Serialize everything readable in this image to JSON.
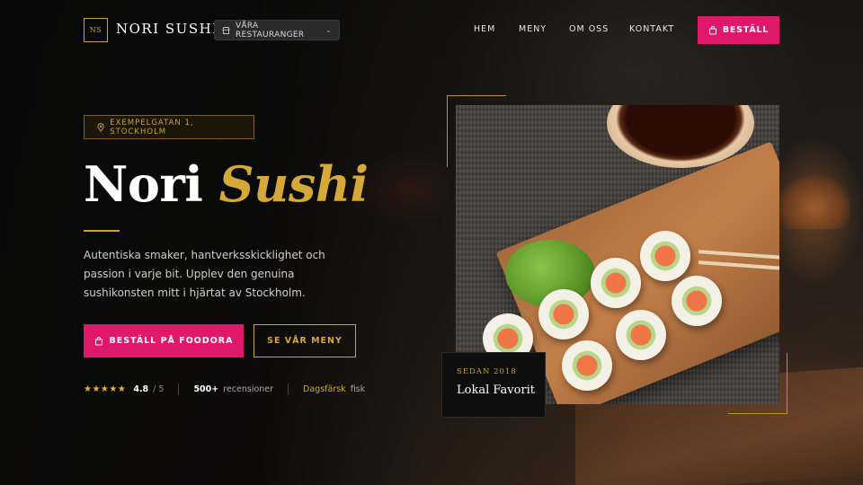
{
  "header": {
    "logo_mark": "NS",
    "logo_text": "NORI SUSHI",
    "restaurant_select": {
      "label": "VÅRA RESTAURANGER",
      "icon": "store-icon"
    },
    "nav": [
      {
        "label": "HEM"
      },
      {
        "label": "MENY"
      },
      {
        "label": "OM OSS"
      },
      {
        "label": "KONTAKT"
      }
    ],
    "order_button": {
      "label": "BESTÄLL",
      "icon": "bag-icon"
    }
  },
  "hero": {
    "address": "EXEMPELGATAN 1, STOCKHOLM",
    "title_main": "Nori ",
    "title_accent": "Sushi",
    "description": "Autentiska smaker, hantverksskicklighet och passion i varje bit. Upplev den genuina sushikonsten mitt i hjärtat av Stockholm.",
    "cta_primary": "BESTÄLL PÅ FOODORA",
    "cta_secondary": "SE VÅR MENY"
  },
  "stats": {
    "stars": "★★★★★",
    "rating": "4.8",
    "rating_max": "/ 5",
    "review_count": "500+",
    "review_label": "recensioner",
    "fresh": "Dagsfärsk",
    "fresh_label": "fisk"
  },
  "badge": {
    "since": "SEDAN 2018",
    "title": "Lokal Favorit"
  },
  "colors": {
    "accent_pink": "#e0186a",
    "accent_gold": "#c9a43a",
    "background": "#0b0b0b"
  }
}
